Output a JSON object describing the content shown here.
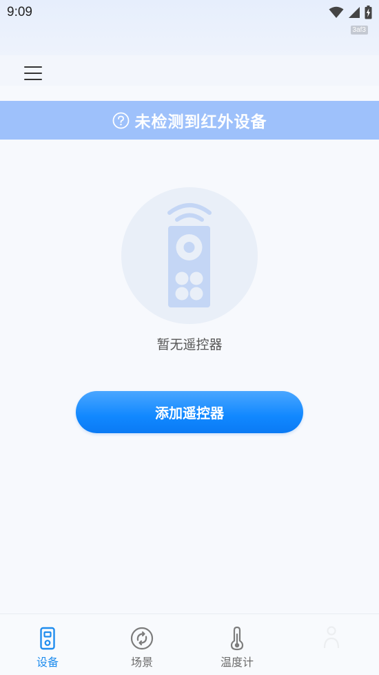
{
  "status_bar": {
    "time": "9:09",
    "build_tag": "3af3",
    "icons": [
      "wifi-icon",
      "signal-icon",
      "battery-charging-icon"
    ]
  },
  "app_bar": {
    "menu_icon": "hamburger-menu-icon"
  },
  "banner": {
    "icon": "question-circle-icon",
    "text": "未检测到红外设备",
    "background_color": "#9ec1fb"
  },
  "empty_state": {
    "icon": "remote-control-icon",
    "label": "暂无遥控器"
  },
  "add_button": {
    "label": "添加遥控器",
    "color": "#1188ff"
  },
  "bottom_nav": {
    "active_color": "#1e8cee",
    "items": [
      {
        "label": "设备",
        "icon": "device-icon",
        "active": true
      },
      {
        "label": "场景",
        "icon": "scene-icon",
        "active": false
      },
      {
        "label": "温度计",
        "icon": "thermometer-icon",
        "active": false
      },
      {
        "label": "",
        "icon": "profile-icon",
        "active": false
      }
    ]
  }
}
